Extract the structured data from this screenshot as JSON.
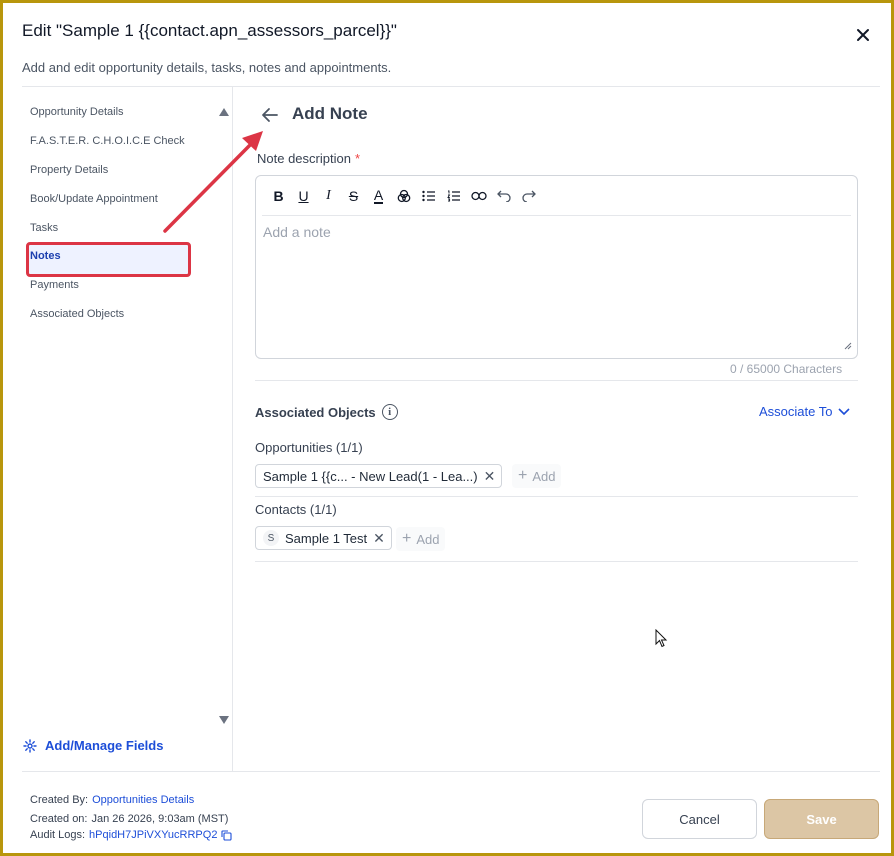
{
  "dialog": {
    "title": "Edit \"Sample 1 {{contact.apn_assessors_parcel}}\"",
    "subtitle": "Add and edit opportunity details, tasks, notes and appointments."
  },
  "sidebar": {
    "items": [
      {
        "label": "Opportunity Details"
      },
      {
        "label": "F.A.S.T.E.R. C.H.O.I.C.E Check"
      },
      {
        "label": "Property Details"
      },
      {
        "label": "Book/Update Appointment"
      },
      {
        "label": "Tasks"
      },
      {
        "label": "Notes"
      },
      {
        "label": "Payments"
      },
      {
        "label": "Associated Objects"
      }
    ],
    "active": "Notes",
    "manage_fields_label": "Add/Manage Fields"
  },
  "panel": {
    "title": "Add Note",
    "note_label": "Note description",
    "required_mark": "*",
    "placeholder": "Add a note",
    "char_count": "0 / 65000 Characters",
    "toolbar": [
      {
        "icon": "bold-icon",
        "glyph": "B"
      },
      {
        "icon": "underline-icon",
        "glyph": "U"
      },
      {
        "icon": "italic-icon",
        "glyph": "I"
      },
      {
        "icon": "strikethrough-icon",
        "glyph": "S"
      },
      {
        "icon": "text-color-icon",
        "glyph": "A"
      },
      {
        "icon": "highlight-icon",
        "glyph": "◎"
      },
      {
        "icon": "bullet-list-icon",
        "glyph": "≡"
      },
      {
        "icon": "numbered-list-icon",
        "glyph": "≡"
      },
      {
        "icon": "link-icon",
        "glyph": "∞"
      },
      {
        "icon": "undo-icon",
        "glyph": "↶"
      },
      {
        "icon": "redo-icon",
        "glyph": "↷"
      }
    ]
  },
  "associated": {
    "label": "Associated Objects",
    "associate_to": "Associate To",
    "opportunities": {
      "label": "Opportunities (1/1)",
      "chip": "Sample 1 {{c... - New Lead(1 - Lea...)",
      "add_label": "Add"
    },
    "contacts": {
      "label": "Contacts (1/1)",
      "avatar": "S",
      "chip": "Sample 1 Test",
      "add_label": "Add"
    }
  },
  "footer": {
    "created_by_label": "Created By:",
    "created_by_value": "Opportunities Details",
    "created_on_label": "Created on:",
    "created_on_value": "Jan 26 2026, 9:03am (MST)",
    "audit_label": "Audit Logs:",
    "audit_value": "hPqidH7JPiVXYucRRPQ2",
    "cancel_label": "Cancel",
    "save_label": "Save"
  },
  "colors": {
    "frame": "#b8960c",
    "accent": "#1d4ed8",
    "annotation": "#dc3545",
    "save_bg": "#dcc6a5"
  }
}
